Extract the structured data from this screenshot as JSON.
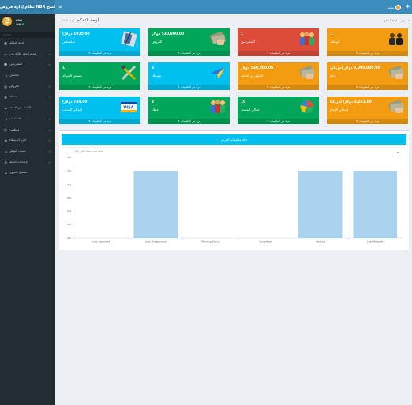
{
  "app": {
    "title": "نظام إدارة قروض NBR لمنح",
    "user": {
      "name": "ميجو",
      "status": "نشط"
    },
    "menu_icon": "bars-icon",
    "settings_icon": "cogs-icon"
  },
  "sidebar": {
    "header": "القائمة",
    "items": [
      {
        "label": "لوحة التحكم",
        "icon": "dashboard-icon",
        "has_submenu": false
      },
      {
        "label": "لوحة الحجز الالكتروني",
        "icon": "laptop-icon",
        "has_submenu": true
      },
      {
        "label": "المقترضين",
        "icon": "users-icon",
        "has_submenu": true
      },
      {
        "label": "معاملتي",
        "icon": "dollar-icon",
        "has_submenu": false
      },
      {
        "label": "القروض",
        "icon": "money-icon",
        "has_submenu": true
      },
      {
        "label": "محفظة",
        "icon": "wallet-icon",
        "has_submenu": true
      },
      {
        "label": "الكشف عن الدفعة",
        "icon": "credit-card-icon",
        "has_submenu": false
      },
      {
        "label": "المعاملات",
        "icon": "dollar-icon",
        "has_submenu": true
      },
      {
        "label": "موظفين",
        "icon": "user-icon",
        "has_submenu": true
      },
      {
        "label": "ادارة الوسطاء",
        "icon": "random-icon",
        "has_submenu": true
      },
      {
        "label": "حساب التوفير",
        "icon": "bank-icon",
        "has_submenu": true
      },
      {
        "label": "الإعدادات العامة",
        "icon": "gear-icon",
        "has_submenu": true
      },
      {
        "label": "تسجيل الخروج",
        "icon": "power-icon",
        "has_submenu": false
      }
    ]
  },
  "content": {
    "title": "لوحة التحكم",
    "subtitle": "لوحة التحكم",
    "breadcrumb": [
      "منزل",
      "لوحة التحكم"
    ]
  },
  "boxes": [
    {
      "value": "1",
      "label": "موظف",
      "footer": "مزيد من المعلومات",
      "color": "#f39c12",
      "icon": "people-meeting-icon"
    },
    {
      "value": "1",
      "label": "المقترضين",
      "footer": "مزيد من المعلومات",
      "color": "#dd4b39",
      "icon": "team-icon"
    },
    {
      "value": "530,800.00 دولار",
      "label": "القروض",
      "footer": "مزيد من المعلومات",
      "color": "#00a65a",
      "icon": "money-hand-icon"
    },
    {
      "value": "1025.00 دولارًا",
      "label": "مدفوعاتي",
      "footer": "مزيد من المعلومات",
      "color": "#00c0ef",
      "icon": "calculator-icon"
    },
    {
      "value": "3,000,000.00 دولار أمريكي",
      "label": "ادفع",
      "footer": "مزيد من المعلومات",
      "color": "#f39c12",
      "icon": "money-hand-icon"
    },
    {
      "value": "530,800.00 دولار",
      "label": "المبلغ عن الدفعة",
      "footer": "مزيد من المعلومات",
      "color": "#f39c12",
      "icon": "money-hand-icon"
    },
    {
      "value": "3",
      "label": "وسطاء",
      "footer": "مزيد من المعلومات",
      "color": "#00c0ef",
      "icon": "paper-plane-icon"
    },
    {
      "value": "1",
      "label": "تأسيس الشركة",
      "footer": "مزيد من المعلومات",
      "color": "#00a65a",
      "icon": "tools-icon"
    },
    {
      "value": "4,221.00 دولارًا أمريكيًا",
      "label": "إجمالي الإيداع",
      "footer": "مزيد من المعلومات",
      "color": "#f39c12",
      "icon": "money-hand-icon"
    },
    {
      "value": "10",
      "label": "إجمالي المسدد",
      "footer": "مزيد من المعلومات",
      "color": "#00a65a",
      "icon": "pie-chart-icon"
    },
    {
      "value": "2",
      "label": "عملاء",
      "footer": "مزيد من المعلومات",
      "color": "#00a65a",
      "icon": "team-icon"
    },
    {
      "value": "740.00 دولارًا",
      "label": "إجمالي السحب",
      "footer": "مزيد من المعلومات",
      "color": "#00c0ef",
      "icon": "visa-icon"
    }
  ],
  "chart_panel": {
    "title": "حالة معلومات القرض",
    "menu_icon": "chart-menu-icon",
    "hint": "اضغط لتحديد منطقة للتكبير عليها"
  },
  "chart_data": {
    "type": "bar",
    "categories": [
      "Loan Approved",
      "Loan Disapproved",
      "Pending Status",
      "Completed",
      "Pending",
      "Loan Request"
    ],
    "values": [
      0,
      1,
      0,
      0,
      1,
      1
    ],
    "title": "",
    "xlabel": "",
    "ylabel": "",
    "ylim": [
      0,
      1.2
    ],
    "yticks": [
      "0.0",
      "0.2",
      "0.4",
      "0.6",
      "0.8",
      "1.0",
      "1.2"
    ],
    "color": "#a9d3ef",
    "grid": false
  }
}
